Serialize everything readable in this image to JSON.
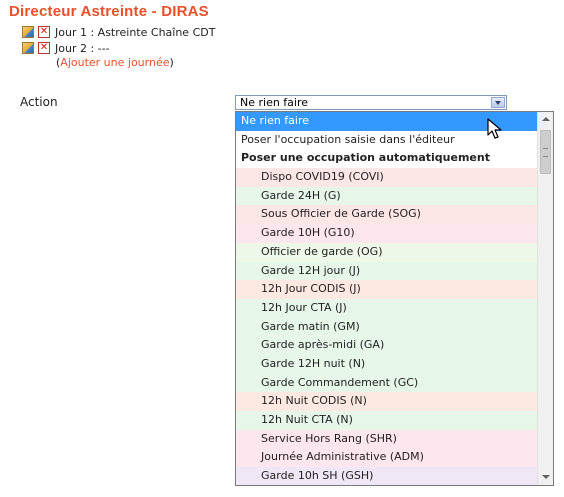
{
  "page": {
    "title": "Directeur Astreinte - DIRAS",
    "days": [
      {
        "label": "Jour 1 : Astreinte Chaîne CDT"
      },
      {
        "label": "Jour 2 : ---"
      }
    ],
    "add_day": {
      "open": "(",
      "link": "Ajouter une journée",
      "close": ")"
    }
  },
  "action": {
    "label": "Action",
    "selected_value": "Ne rien faire",
    "options": [
      {
        "label": "Ne rien faire",
        "kind": "selected",
        "color": "#3399ff"
      },
      {
        "label": "Poser l'occupation saisie dans l'éditeur",
        "kind": "plain",
        "color": "#ffffff"
      },
      {
        "label": "Poser une occupation automatiquement",
        "kind": "group",
        "color": "#ffffff"
      },
      {
        "label": "Dispo COVID19 (COVI)",
        "kind": "sub",
        "color": "#fde6e6"
      },
      {
        "label": "Garde 24H (G)",
        "kind": "sub",
        "color": "#e6f7ea"
      },
      {
        "label": "Sous Officier de Garde (SOG)",
        "kind": "sub",
        "color": "#fde6e6"
      },
      {
        "label": "Garde 10H (G10)",
        "kind": "sub",
        "color": "#fde6ee"
      },
      {
        "label": "Officier de garde (OG)",
        "kind": "sub",
        "color": "#eef8e8"
      },
      {
        "label": "Garde 12H jour (J)",
        "kind": "sub",
        "color": "#e6f7ea"
      },
      {
        "label": "12h Jour CODIS (J)",
        "kind": "sub",
        "color": "#fde9e1"
      },
      {
        "label": "12h Jour CTA (J)",
        "kind": "sub",
        "color": "#e6f7ea"
      },
      {
        "label": "Garde matin (GM)",
        "kind": "sub",
        "color": "#e6f7ea"
      },
      {
        "label": "Garde après-midi (GA)",
        "kind": "sub",
        "color": "#e6f7ea"
      },
      {
        "label": "Garde 12H nuit (N)",
        "kind": "sub",
        "color": "#e6f7ea"
      },
      {
        "label": "Garde Commandement (GC)",
        "kind": "sub",
        "color": "#e6f7ea"
      },
      {
        "label": "12h Nuit CODIS (N)",
        "kind": "sub",
        "color": "#fde9e1"
      },
      {
        "label": "12h Nuit CTA (N)",
        "kind": "sub",
        "color": "#e6f7ea"
      },
      {
        "label": "Service Hors Rang (SHR)",
        "kind": "sub",
        "color": "#fde6ee"
      },
      {
        "label": "Journée Administrative (ADM)",
        "kind": "sub",
        "color": "#fde6ee"
      },
      {
        "label": "Garde 10h SH (GSH)",
        "kind": "sub",
        "color": "#efe6f6"
      }
    ]
  },
  "colors": {
    "accent": "#e8502a",
    "selection": "#3399ff"
  }
}
